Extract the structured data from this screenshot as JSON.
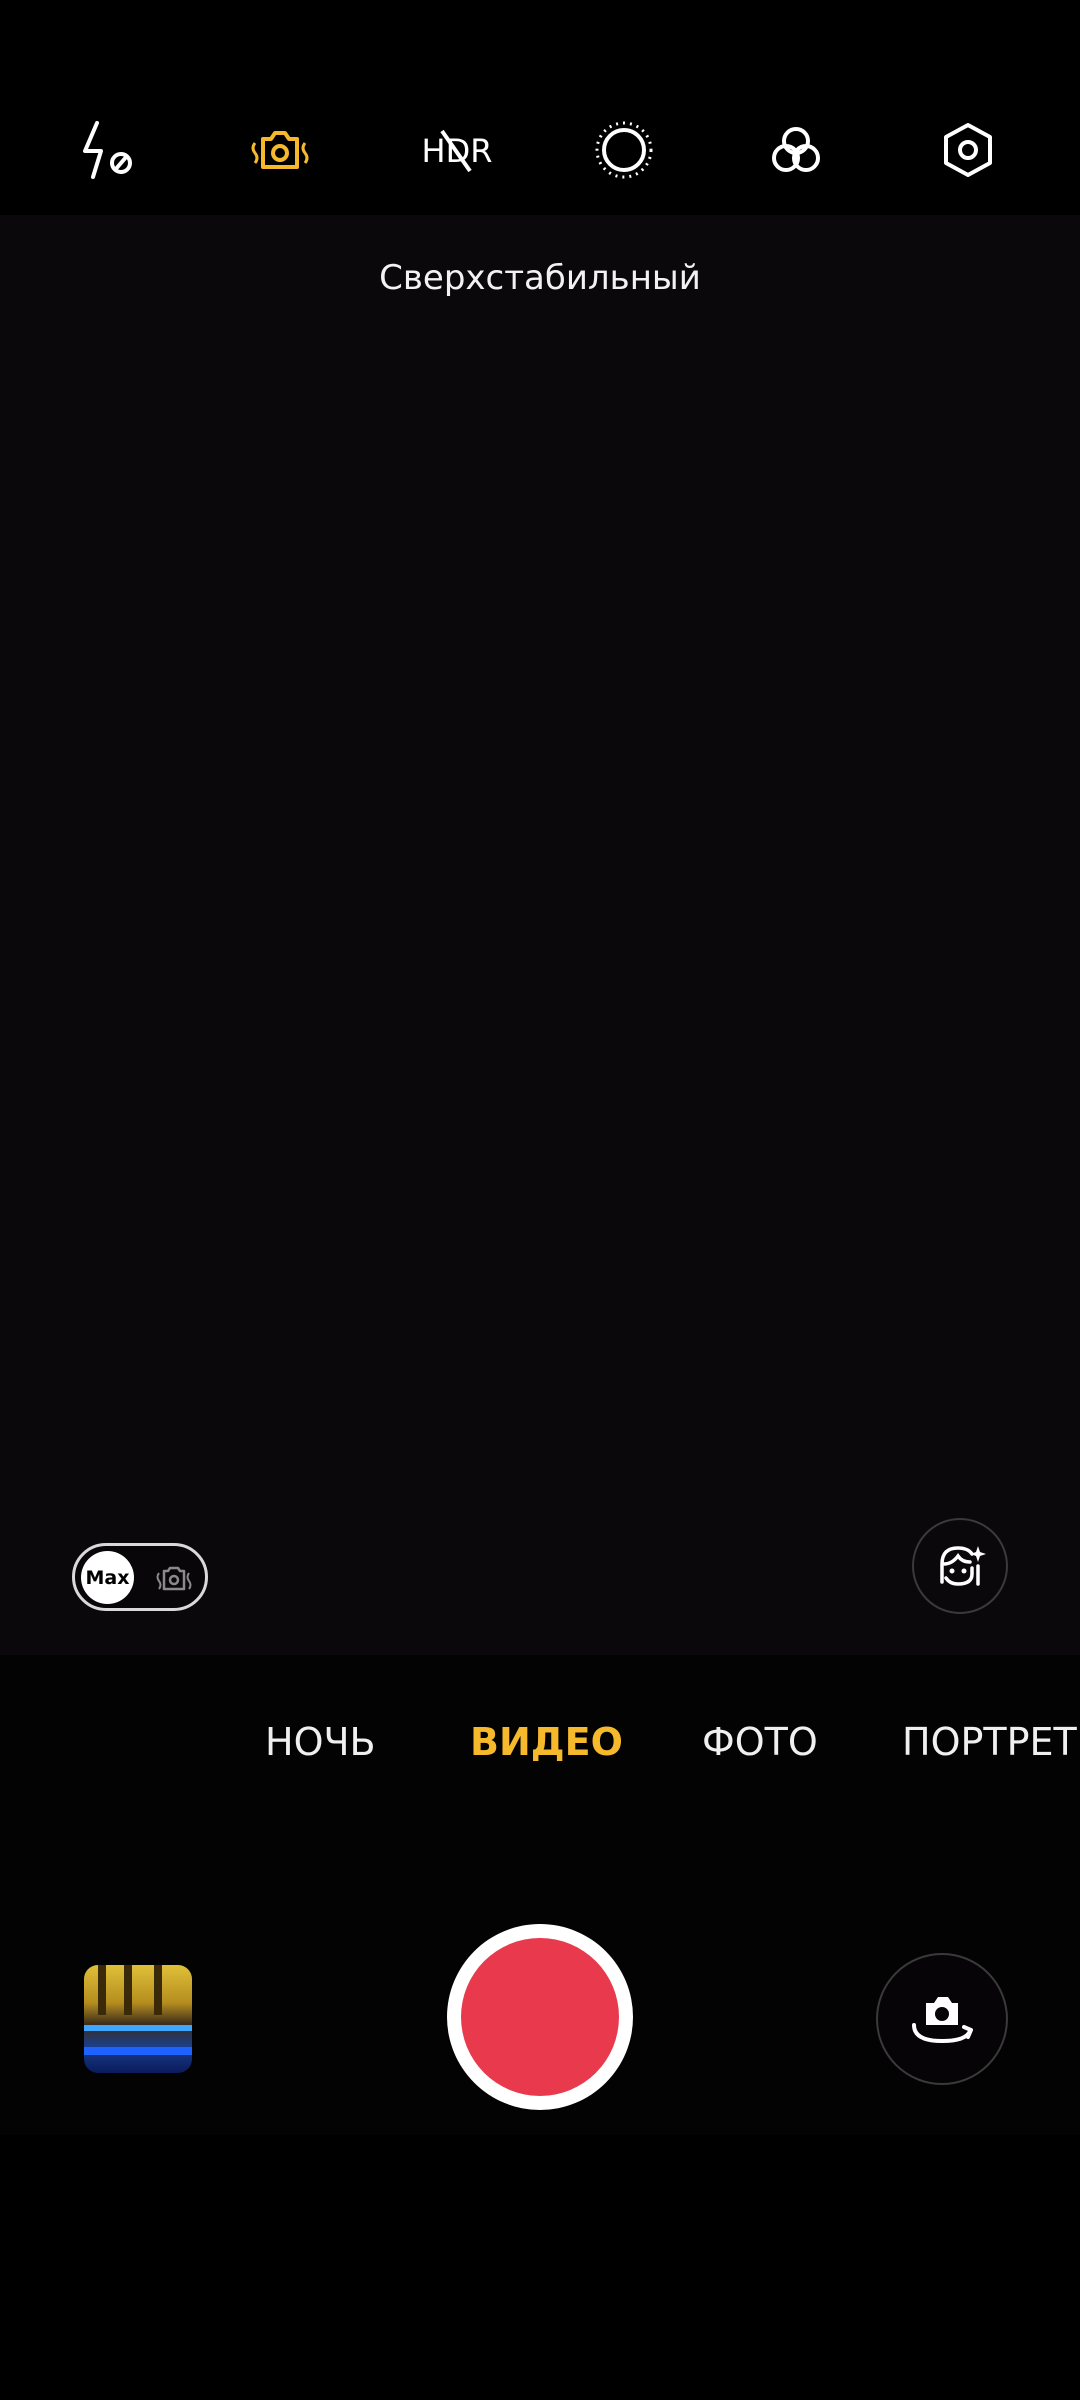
{
  "top_bar": {
    "flash": "flash-off-icon",
    "stabilization": "super-stabilization-icon",
    "hdr": "hdr-off-icon",
    "timer": "timer-icon",
    "filters": "filters-icon",
    "settings": "settings-icon",
    "hdr_label": "HDR"
  },
  "viewfinder": {
    "mode_hint": "Сверхстабильный"
  },
  "controls": {
    "max_toggle_label": "Max",
    "beauty": "beauty-face-icon"
  },
  "modes": {
    "items": [
      "НОЧЬ",
      "ВИДЕО",
      "ФОТО",
      "ПОРТРЕТ"
    ],
    "active": "ВИДЕО"
  },
  "colors": {
    "accent": "#f7b92c",
    "record": "#e83a4c",
    "background": "#000000"
  }
}
